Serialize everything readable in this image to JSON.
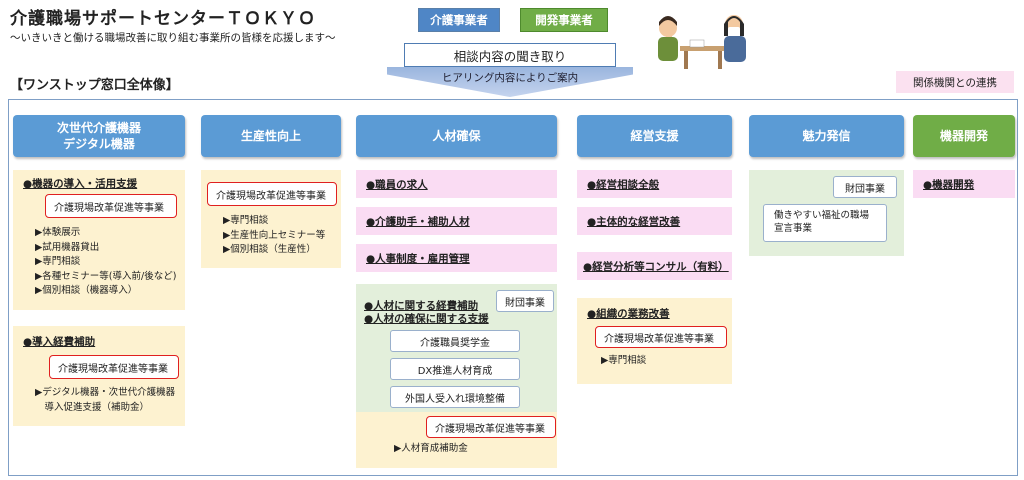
{
  "header": {
    "title": "介護職場サポートセンターＴＯＫＹＯ",
    "subtitle": "～いきいきと働ける職場改善に取り組む事業所の皆様を応援します～",
    "section_label": "【ワンストップ窓口全体像】"
  },
  "top_flow": {
    "tag_care": "介護事業者",
    "tag_dev": "開発事業者",
    "consult": "相談内容の聞き取り",
    "arrow_text": "ヒアリング内容によりご案内",
    "relation": "関係機関との連携"
  },
  "columns": {
    "digital": {
      "header": "次世代介護機器\nデジタル機器",
      "box1": {
        "heading": "●機器の導入・活用支援",
        "highlight": "介護現場改革促進等事業",
        "bullets": [
          "▶体験展示",
          "▶試用機器貸出",
          "▶専門相談",
          "▶各種セミナー等(導入前/後など)",
          "▶個別相談（機器導入）"
        ]
      },
      "box2": {
        "heading": "●導入経費補助",
        "highlight": "介護現場改革促進等事業",
        "bullets": [
          "▶デジタル機器・次世代介護機器",
          "　導入促進支援（補助金）"
        ]
      }
    },
    "productivity": {
      "header": "生産性向上",
      "highlight": "介護現場改革促進等事業",
      "bullets": [
        "▶専門相談",
        "▶生産性向上セミナー等",
        "▶個別相談（生産性）"
      ]
    },
    "hr": {
      "header": "人材確保",
      "items": [
        "●職員の求人",
        "●介護助手・補助人材",
        "●人事制度・雇用管理"
      ],
      "green_box": {
        "heading1": "●人材に関する経費補助",
        "heading2": "●人材の確保に関する支援",
        "foundation": "財団事業",
        "programs": [
          "介護職員奨学金",
          "DX推進人材育成",
          "外国人受入れ環境整備"
        ]
      },
      "yellow_box": {
        "highlight": "介護現場改革促進等事業",
        "bullet": "▶人材育成補助金"
      }
    },
    "management": {
      "header": "経営支援",
      "items": [
        "●経営相談全般",
        "●主体的な経営改善",
        "●経営分析等コンサル（有料）"
      ],
      "yellow_box": {
        "heading": "●組織の業務改善",
        "highlight": "介護現場改革促進等事業",
        "bullet": "▶専門相談"
      }
    },
    "appeal": {
      "header": "魅力発信",
      "foundation": "財団事業",
      "declaration": "働きやすい福祉の職場\n宣言事業"
    },
    "device_dev": {
      "header": "機器開発",
      "item": "●機器開発"
    }
  },
  "colors": {
    "header_blue": "#5b9bd5",
    "header_green": "#70ad47",
    "highlight_red": "#e02020",
    "box_yellow": "#fdf2d0",
    "box_pink": "#fadcf3",
    "box_green": "#e3efdb"
  }
}
